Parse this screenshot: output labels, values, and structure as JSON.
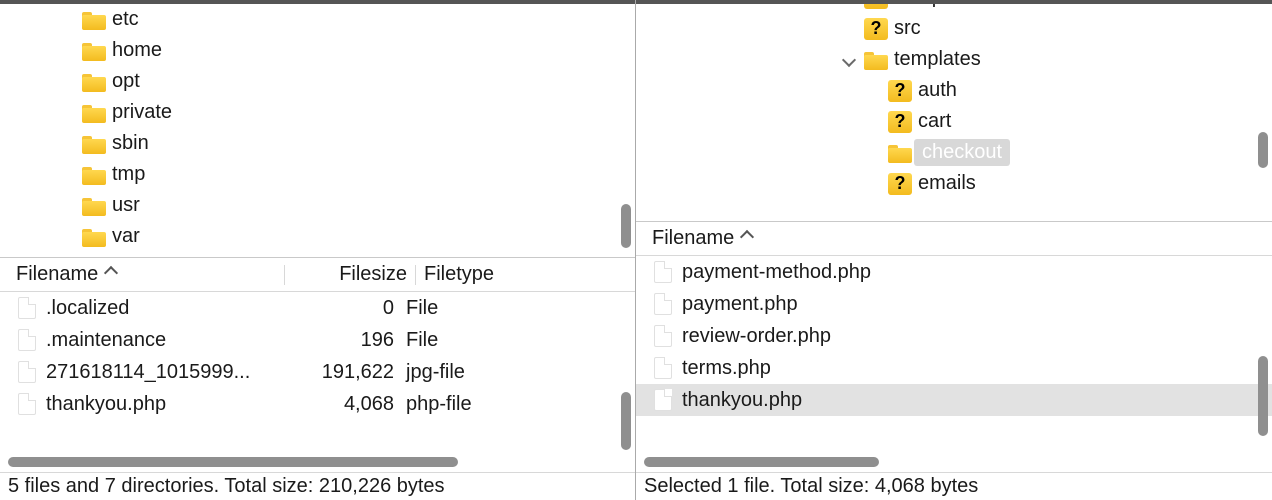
{
  "left": {
    "tree": [
      {
        "icon": "folder",
        "label": "etc",
        "indent": 82
      },
      {
        "icon": "folder",
        "label": "home",
        "indent": 82
      },
      {
        "icon": "folder",
        "label": "opt",
        "indent": 82
      },
      {
        "icon": "folder",
        "label": "private",
        "indent": 82
      },
      {
        "icon": "folder",
        "label": "sbin",
        "indent": 82
      },
      {
        "icon": "folder",
        "label": "tmp",
        "indent": 82
      },
      {
        "icon": "folder",
        "label": "usr",
        "indent": 82
      },
      {
        "icon": "folder",
        "label": "var",
        "indent": 82
      }
    ],
    "columns": {
      "name": "Filename",
      "size": "Filesize",
      "type": "Filetype"
    },
    "files": [
      {
        "name": ".localized",
        "size": "0",
        "type": "File"
      },
      {
        "name": ".maintenance",
        "size": "196",
        "type": "File"
      },
      {
        "name": "271618114_1015999...",
        "size": "191,622",
        "type": "jpg-file"
      },
      {
        "name": "thankyou.php",
        "size": "4,068",
        "type": "php-file"
      }
    ],
    "status": "5 files and 7 directories. Total size: 210,226 bytes"
  },
  "right": {
    "tree": [
      {
        "icon": "qfolder",
        "label": "sample-data",
        "indent": 228,
        "cut": true
      },
      {
        "icon": "qfolder",
        "label": "src",
        "indent": 228
      },
      {
        "icon": "folder",
        "label": "templates",
        "indent": 228,
        "expander": true
      },
      {
        "icon": "qfolder",
        "label": "auth",
        "indent": 252
      },
      {
        "icon": "qfolder",
        "label": "cart",
        "indent": 252
      },
      {
        "icon": "folder",
        "label": "checkout",
        "indent": 252,
        "selected": true
      },
      {
        "icon": "qfolder",
        "label": "emails",
        "indent": 252
      }
    ],
    "columns": {
      "name": "Filename"
    },
    "files": [
      {
        "name": "payment-method.php"
      },
      {
        "name": "payment.php"
      },
      {
        "name": "review-order.php"
      },
      {
        "name": "terms.php"
      },
      {
        "name": "thankyou.php",
        "selected": true
      }
    ],
    "status": "Selected 1 file. Total size: 4,068 bytes"
  }
}
